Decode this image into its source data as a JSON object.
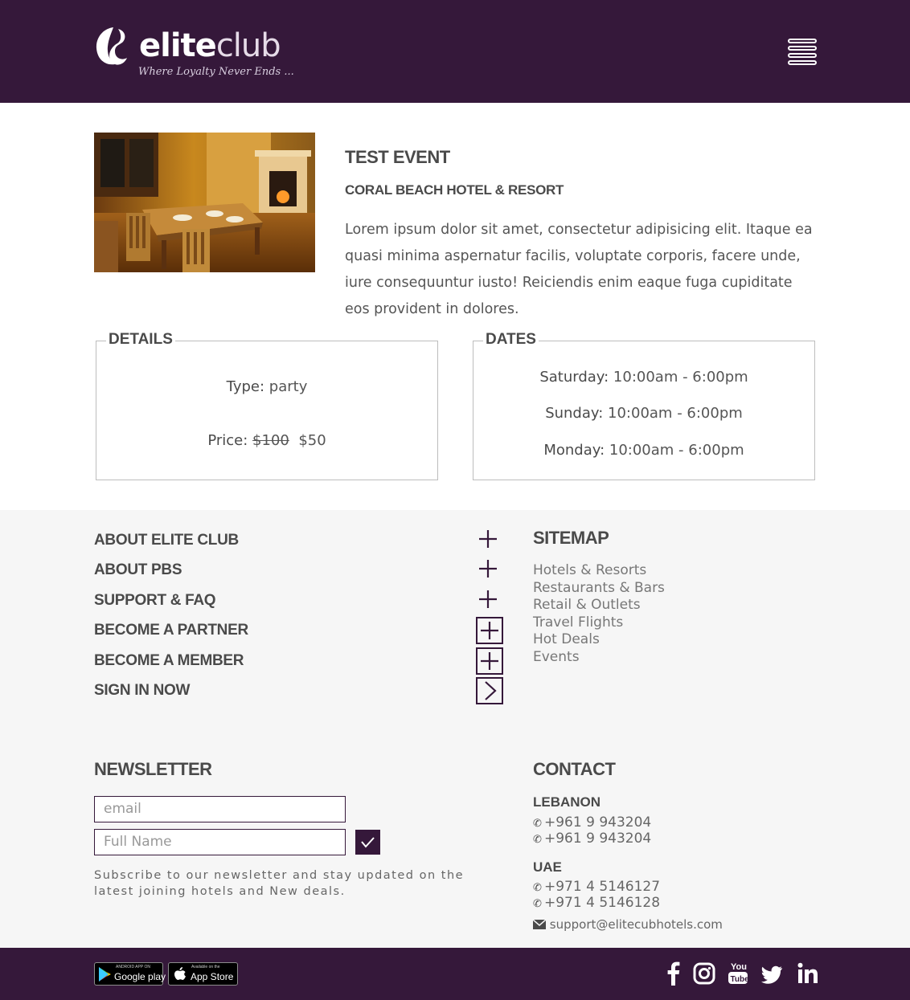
{
  "header": {
    "brand_name_bold": "elite",
    "brand_name_light": "club",
    "tagline": "Where Loyalty Never Ends ...",
    "menu_icon": "hamburger-menu-icon"
  },
  "event": {
    "title": "TEST EVENT",
    "venue": "CORAL BEACH HOTEL & RESORT",
    "description": "Lorem ipsum dolor sit amet, consectetur adipisicing elit. Itaque ea quasi minima aspernatur facilis, voluptate corporis, facere unde, iure consequuntur iusto! Reiciendis enim eaque fuga cupiditate eos provident in dolores.",
    "details": {
      "legend": "DETAILS",
      "type_label": "Type:",
      "type_value": "party",
      "price_label": "Price:",
      "price_old": "$100",
      "price_new": "$50"
    },
    "dates": {
      "legend": "DATES",
      "items": [
        {
          "day": "Saturday:",
          "time": "10:00am - 6:00pm"
        },
        {
          "day": "Sunday:",
          "time": "10:00am - 6:00pm"
        },
        {
          "day": "Monday:",
          "time": "10:00am - 6:00pm"
        }
      ]
    }
  },
  "accordion": [
    {
      "label": "ABOUT ELITE CLUB",
      "icon": "plus-icon"
    },
    {
      "label": "ABOUT PBS",
      "icon": "plus-icon"
    },
    {
      "label": "SUPPORT & FAQ",
      "icon": "plus-icon"
    },
    {
      "label": "BECOME A PARTNER",
      "icon": "plus-icon"
    },
    {
      "label": "BECOME A MEMBER",
      "icon": "plus-icon"
    },
    {
      "label": "SIGN IN NOW",
      "icon": "chevron-right-icon"
    }
  ],
  "sitemap": {
    "title": "SITEMAP",
    "links": [
      "Hotels & Resorts",
      "Restaurants & Bars",
      "Retail & Outlets",
      "Travel Flights",
      "Hot Deals",
      "Events"
    ]
  },
  "newsletter": {
    "title": "NEWSLETTER",
    "email_placeholder": "email",
    "name_placeholder": "Full Name",
    "note": "Subscribe to our newsletter and stay updated on the latest joining hotels and New deals."
  },
  "contact": {
    "title": "CONTACT",
    "lebanon_label": "LEBANON",
    "lebanon_phones": [
      "+961 9 943204",
      "+961 9 943204"
    ],
    "uae_label": "UAE",
    "uae_phones": [
      "+971 4 5146127",
      "+971 4 5146128"
    ],
    "email": "support@elitecubhotels.com"
  },
  "footer_bar": {
    "google_small": "ANDROID APP ON",
    "google_big": "Google play",
    "apple_small": "Available on the",
    "apple_big": "App Store",
    "social": [
      "facebook-icon",
      "instagram-icon",
      "youtube-icon",
      "twitter-icon",
      "linkedin-icon"
    ]
  },
  "colors": {
    "brand_purple": "#35183a",
    "footer_bg": "#f6f6f6",
    "text_dark": "#4a4a4a"
  }
}
